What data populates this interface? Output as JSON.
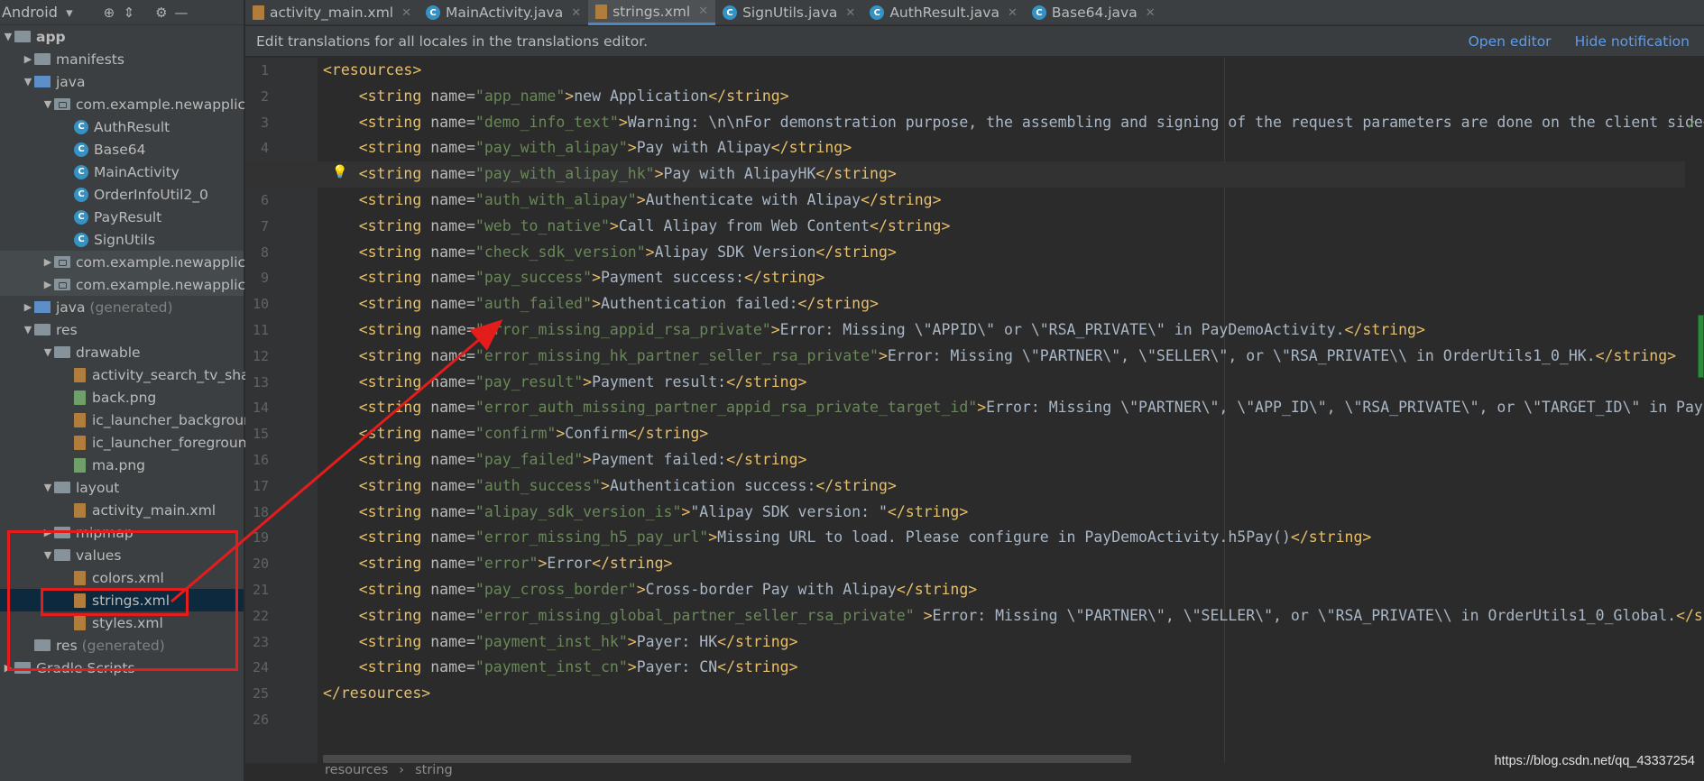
{
  "sidebar": {
    "title": "Android",
    "icons": [
      "target-icon",
      "collapse-icon",
      "gear-icon",
      "minimize-icon"
    ],
    "tree": [
      {
        "indent": 0,
        "arrow": "▼",
        "kind": "module",
        "label": "app",
        "bold": true
      },
      {
        "indent": 1,
        "arrow": "▶",
        "kind": "folder",
        "label": "manifests"
      },
      {
        "indent": 1,
        "arrow": "▼",
        "kind": "folder",
        "label": "java"
      },
      {
        "indent": 2,
        "arrow": "▼",
        "kind": "package",
        "label": "com.example.newapplicatio"
      },
      {
        "indent": 3,
        "arrow": "",
        "kind": "class",
        "label": "AuthResult"
      },
      {
        "indent": 3,
        "arrow": "",
        "kind": "class",
        "label": "Base64"
      },
      {
        "indent": 3,
        "arrow": "",
        "kind": "class",
        "label": "MainActivity"
      },
      {
        "indent": 3,
        "arrow": "",
        "kind": "class",
        "label": "OrderInfoUtil2_0"
      },
      {
        "indent": 3,
        "arrow": "",
        "kind": "class",
        "label": "PayResult"
      },
      {
        "indent": 3,
        "arrow": "",
        "kind": "class",
        "label": "SignUtils"
      },
      {
        "indent": 2,
        "arrow": "▶",
        "kind": "package",
        "label": "com.example.newapplicatio",
        "band": true
      },
      {
        "indent": 2,
        "arrow": "▶",
        "kind": "package",
        "label": "com.example.newapplicatio",
        "band": true
      },
      {
        "indent": 1,
        "arrow": "▶",
        "kind": "folder",
        "label": "java",
        "suffix": " (generated)"
      },
      {
        "indent": 1,
        "arrow": "▼",
        "kind": "folder",
        "label": "res"
      },
      {
        "indent": 2,
        "arrow": "▼",
        "kind": "folder",
        "label": "drawable"
      },
      {
        "indent": 3,
        "arrow": "",
        "kind": "xml",
        "label": "activity_search_tv_shape."
      },
      {
        "indent": 3,
        "arrow": "",
        "kind": "img",
        "label": "back.png"
      },
      {
        "indent": 3,
        "arrow": "",
        "kind": "xml",
        "label": "ic_launcher_background."
      },
      {
        "indent": 3,
        "arrow": "",
        "kind": "xml",
        "label": "ic_launcher_foreground.x"
      },
      {
        "indent": 3,
        "arrow": "",
        "kind": "img",
        "label": "ma.png"
      },
      {
        "indent": 2,
        "arrow": "▼",
        "kind": "folder",
        "label": "layout"
      },
      {
        "indent": 3,
        "arrow": "",
        "kind": "xml",
        "label": "activity_main.xml"
      },
      {
        "indent": 2,
        "arrow": "▶",
        "kind": "folder",
        "label": "mipmap"
      },
      {
        "indent": 2,
        "arrow": "▼",
        "kind": "folder",
        "label": "values"
      },
      {
        "indent": 3,
        "arrow": "",
        "kind": "xml",
        "label": "colors.xml"
      },
      {
        "indent": 3,
        "arrow": "",
        "kind": "xml",
        "label": "strings.xml",
        "selected": true
      },
      {
        "indent": 3,
        "arrow": "",
        "kind": "xml",
        "label": "styles.xml"
      },
      {
        "indent": 1,
        "arrow": "",
        "kind": "folder",
        "label": "res",
        "suffix": " (generated)"
      },
      {
        "indent": 0,
        "arrow": "▶",
        "kind": "gradle",
        "label": "Gradle Scripts"
      }
    ]
  },
  "tabs": [
    {
      "label": "activity_main.xml",
      "kind": "xml"
    },
    {
      "label": "MainActivity.java",
      "kind": "class"
    },
    {
      "label": "strings.xml",
      "kind": "xml",
      "active": true
    },
    {
      "label": "SignUtils.java",
      "kind": "class"
    },
    {
      "label": "AuthResult.java",
      "kind": "class"
    },
    {
      "label": "Base64.java",
      "kind": "class"
    }
  ],
  "notification": {
    "text": "Edit translations for all locales in the translations editor.",
    "open_editor": "Open editor",
    "hide": "Hide notification"
  },
  "editor": {
    "current_line": 5,
    "lines": [
      {
        "n": 1,
        "type": "open",
        "text": "<resources>"
      },
      {
        "n": 2,
        "name": "app_name",
        "value": "new Application"
      },
      {
        "n": 3,
        "name": "demo_info_text",
        "value": "Warning: \\n\\nFor demonstration purpose, the assembling and signing of the request parameters are done on the client side"
      },
      {
        "n": 4,
        "name": "pay_with_alipay",
        "value": "Pay with Alipay"
      },
      {
        "n": 5,
        "name": "pay_with_alipay_hk",
        "value": "Pay with AlipayHK"
      },
      {
        "n": 6,
        "name": "auth_with_alipay",
        "value": "Authenticate with Alipay"
      },
      {
        "n": 7,
        "name": "web_to_native",
        "value": "Call Alipay from Web Content"
      },
      {
        "n": 8,
        "name": "check_sdk_version",
        "value": "Alipay SDK Version"
      },
      {
        "n": 9,
        "name": "pay_success",
        "value": "Payment success:"
      },
      {
        "n": 10,
        "name": "auth_failed",
        "value": "Authentication failed:"
      },
      {
        "n": 11,
        "name": "error_missing_appid_rsa_private",
        "value": "Error: Missing \\\"APPID\\\" or \\\"RSA_PRIVATE\\\" in PayDemoActivity."
      },
      {
        "n": 12,
        "name": "error_missing_hk_partner_seller_rsa_private",
        "value": "Error: Missing \\\"PARTNER\\\", \\\"SELLER\\\", or \\\"RSA_PRIVATE\\\\ in OrderUtils1_0_HK."
      },
      {
        "n": 13,
        "name": "pay_result",
        "value": "Payment result:"
      },
      {
        "n": 14,
        "name": "error_auth_missing_partner_appid_rsa_private_target_id",
        "value": "Error: Missing \\\"PARTNER\\\", \\\"APP_ID\\\", \\\"RSA_PRIVATE\\\", or \\\"TARGET_ID\\\" in PayDemoActivity."
      },
      {
        "n": 15,
        "name": "confirm",
        "value": "Confirm"
      },
      {
        "n": 16,
        "name": "pay_failed",
        "value": "Payment failed:"
      },
      {
        "n": 17,
        "name": "auth_success",
        "value": "Authentication success:"
      },
      {
        "n": 18,
        "name": "alipay_sdk_version_is",
        "value": "\"Alipay SDK version: \""
      },
      {
        "n": 19,
        "name": "error_missing_h5_pay_url",
        "value": "Missing URL to load. Please configure in PayDemoActivity.h5Pay()"
      },
      {
        "n": 20,
        "name": "error",
        "value": "Error"
      },
      {
        "n": 21,
        "name": "pay_cross_border",
        "value": "Cross-border Pay with Alipay"
      },
      {
        "n": 22,
        "name": "error_missing_global_partner_seller_rsa_private",
        "value": "Error: Missing \\\"PARTNER\\\", \\\"SELLER\\\", or \\\"RSA_PRIVATE\\\\ in OrderUtils1_0_Global.",
        "space_before_close": true
      },
      {
        "n": 23,
        "name": "payment_inst_hk",
        "value": "Payer: HK"
      },
      {
        "n": 24,
        "name": "payment_inst_cn",
        "value": "Payer: CN"
      },
      {
        "n": 25,
        "type": "close",
        "text": "</resources>"
      },
      {
        "n": 26,
        "type": "empty",
        "text": ""
      }
    ]
  },
  "breadcrumb": [
    "resources",
    "string"
  ],
  "watermark": "https://blog.csdn.net/qq_43337254",
  "colors": {
    "tag": "#e8bf6a",
    "attr_value": "#6a8759",
    "text": "#a9b7c6",
    "annotation": "#e51c1c",
    "link": "#589df6"
  }
}
